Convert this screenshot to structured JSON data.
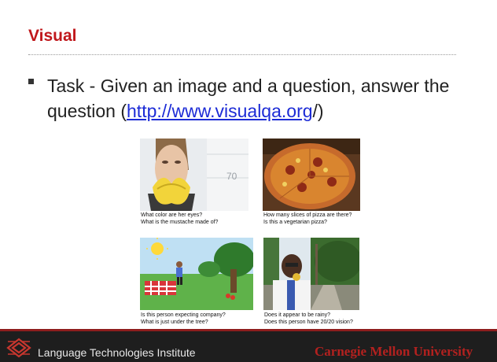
{
  "slide": {
    "title": "Visual",
    "bullet_prefix": "Task - Given an image and a question, answer the question (",
    "bullet_link": "http://www.visualqa.org",
    "bullet_suffix": "/)"
  },
  "examples": [
    {
      "q1": "What color are her eyes?",
      "q2": "What is the mustache made of?"
    },
    {
      "q1": "How many slices of pizza are there?",
      "q2": "Is this a vegetarian pizza?"
    },
    {
      "q1": "Is this person expecting company?",
      "q2": "What is just under the tree?"
    },
    {
      "q1": "Does it appear to be rainy?",
      "q2": "Does this person have 20/20 vision?"
    }
  ],
  "footer": {
    "institute": "Language Technologies Institute",
    "university": "Carnegie Mellon University"
  },
  "colors": {
    "title": "#c0171b",
    "link": "#1c2bd6",
    "footer_bg": "#1e1e1e",
    "cmu": "#b3211f"
  }
}
